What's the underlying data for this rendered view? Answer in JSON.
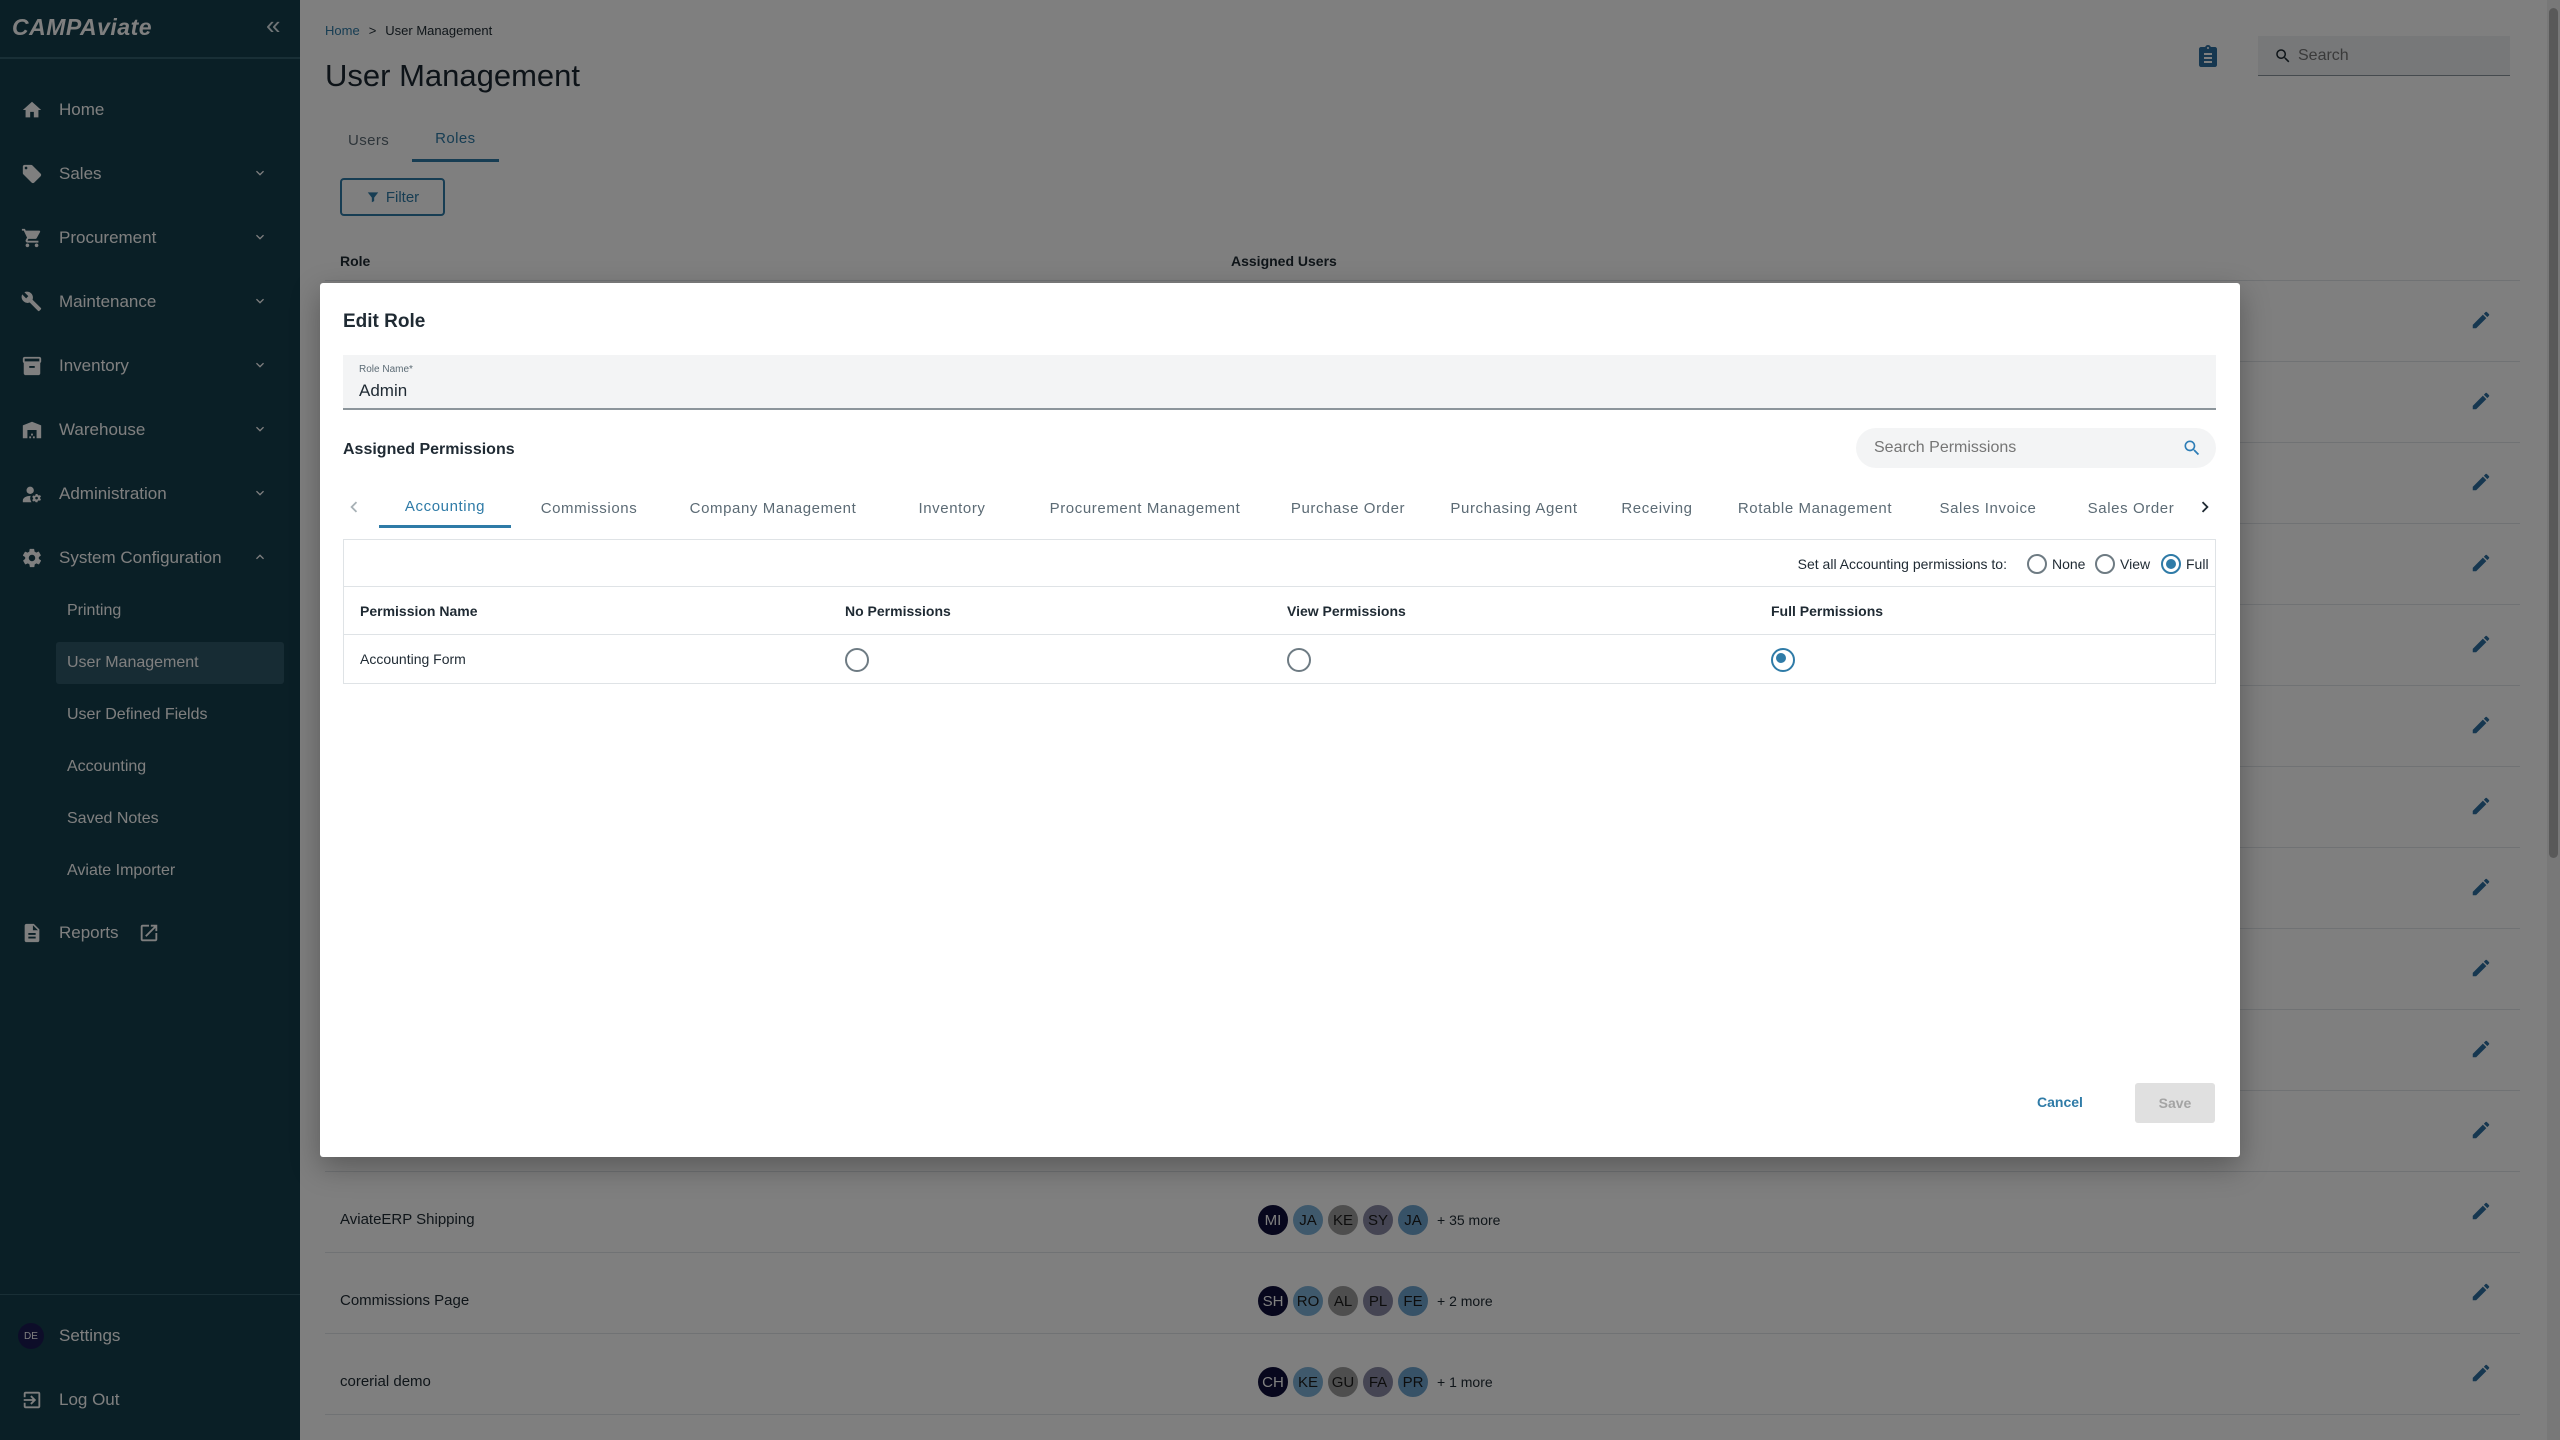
{
  "sidebar": {
    "logo": "CAMPAviate",
    "collapse_label": "«",
    "items": [
      {
        "label": "Home",
        "icon": "home-icon"
      },
      {
        "label": "Sales",
        "icon": "tag-icon"
      },
      {
        "label": "Procurement",
        "icon": "cart-icon"
      },
      {
        "label": "Maintenance",
        "icon": "tools-icon"
      },
      {
        "label": "Inventory",
        "icon": "archive-icon"
      },
      {
        "label": "Warehouse",
        "icon": "warehouse-icon"
      },
      {
        "label": "Administration",
        "icon": "user-gear-icon"
      },
      {
        "label": "System Configuration",
        "icon": "gear-icon"
      }
    ],
    "subitems": [
      "Printing",
      "User Management",
      "User Defined Fields",
      "Accounting",
      "Saved Notes",
      "Aviate Importer"
    ],
    "reports": "Reports",
    "settings": "Settings",
    "settings_avatar": "DE",
    "logout": "Log Out"
  },
  "header": {
    "breadcrumb": {
      "home": "Home",
      "separator": ">",
      "current": "User Management"
    },
    "title": "User Management",
    "search_placeholder": "Search",
    "tabs": [
      "Users",
      "Roles"
    ]
  },
  "filter_label": "Filter",
  "table": {
    "headers": {
      "role": "Role",
      "users": "Assigned Users"
    },
    "rows": [
      {
        "name": "AviateERP Shipping",
        "avatars": [
          "MI",
          "JA",
          "KE",
          "SY",
          "JA"
        ],
        "more": "+ 35 more"
      },
      {
        "name": "Commissions Page",
        "avatars": [
          "SH",
          "RO",
          "AL",
          "PL",
          "FE"
        ],
        "more": "+ 2 more"
      },
      {
        "name": "corerial demo",
        "avatars": [
          "CH",
          "KE",
          "GU",
          "FA",
          "PR"
        ],
        "more": "+ 1 more"
      }
    ],
    "avatar_colors": [
      "#0f0f3a",
      "#7fb3d8",
      "#9c9c9c",
      "#8a8aa6",
      "#6fa4cf"
    ]
  },
  "dialog": {
    "title": "Edit Role",
    "role_name_label": "Role Name*",
    "role_name_value": "Admin",
    "assigned_permissions": "Assigned Permissions",
    "search_placeholder": "Search Permissions",
    "tabs": [
      "Accounting",
      "Commissions",
      "Company Management",
      "Inventory",
      "Procurement Management",
      "Purchase Order",
      "Purchasing Agent",
      "Receiving",
      "Rotable Management",
      "Sales Invoice",
      "Sales Order"
    ],
    "active_tab": "Accounting",
    "set_all_label": "Set all Accounting permissions to:",
    "set_all_options": [
      "None",
      "View",
      "Full"
    ],
    "set_all_selected": "Full",
    "columns": [
      "Permission Name",
      "No Permissions",
      "View Permissions",
      "Full Permissions"
    ],
    "permissions": [
      {
        "name": "Accounting Form",
        "level": "Full"
      }
    ],
    "cancel": "Cancel",
    "save": "Save"
  },
  "colors": {
    "sidebar_bg": "#153f4d",
    "accent": "#2f7ba7",
    "active_subitem": "#2f5868"
  }
}
